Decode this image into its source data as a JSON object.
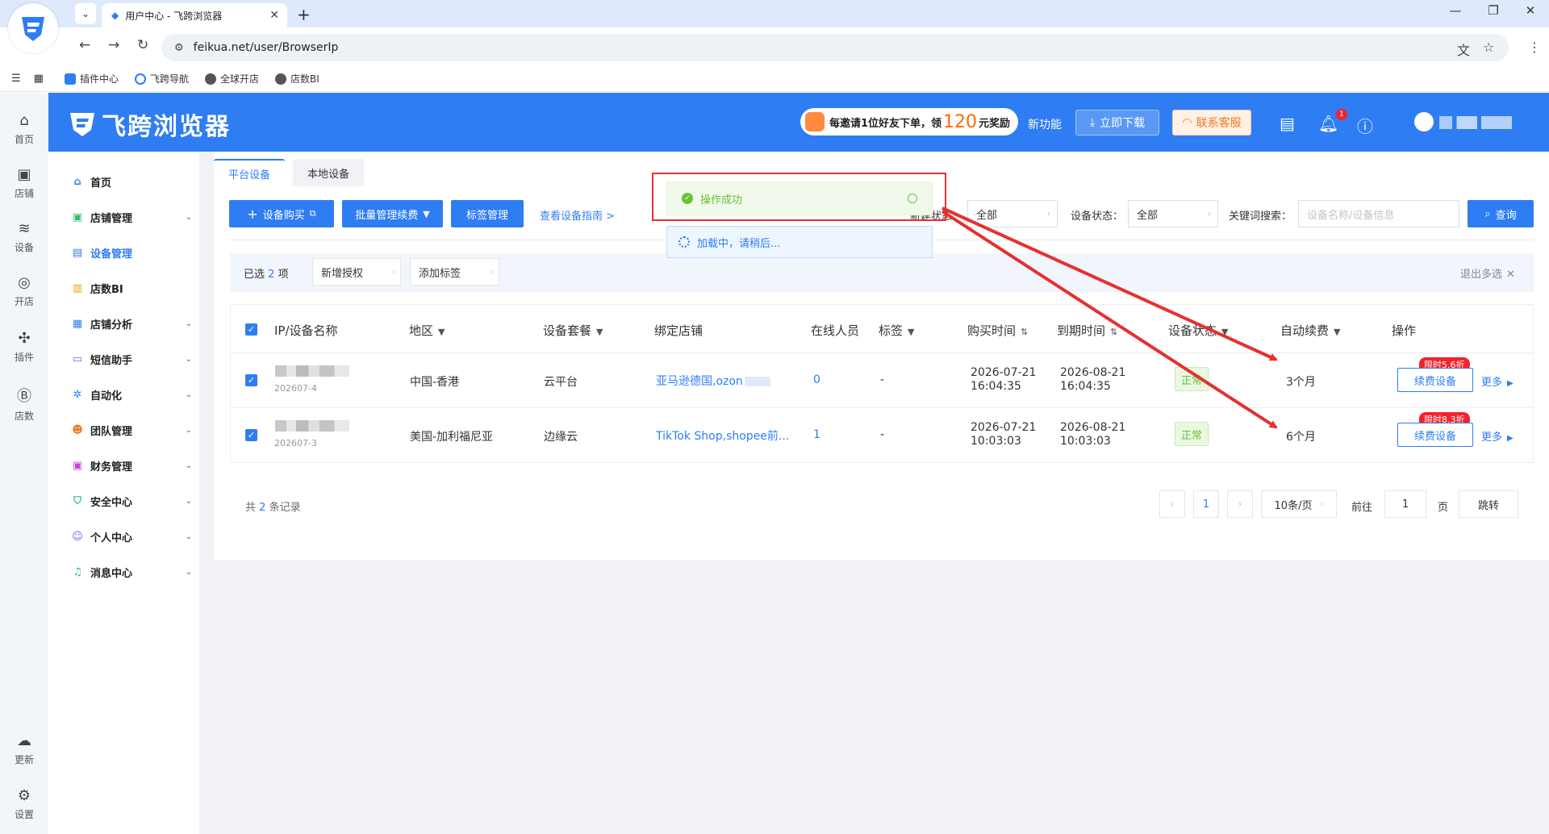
{
  "browser": {
    "tab_title": "用户中心 - 飞跨浏览器",
    "url": "feikua.net/user/BrowserIp",
    "bookmarks": [
      "插件中心",
      "飞跨导航",
      "全球开店",
      "店数BI"
    ]
  },
  "rail": {
    "items": [
      "首页",
      "店铺",
      "设备",
      "开店",
      "插件",
      "店数"
    ],
    "bottom": [
      "更新",
      "设置"
    ]
  },
  "header": {
    "brand": "飞跨浏览器",
    "invite_pre": "每邀请1位好友下单，领",
    "invite_num": "120",
    "invite_post": "元奖励",
    "new_feature": "新功能",
    "download": "立即下载",
    "contact": "联系客服",
    "bell_count": "1"
  },
  "sidebar": {
    "items": [
      {
        "label": "首页",
        "icon": "home-icon"
      },
      {
        "label": "店铺管理",
        "icon": "shop-icon"
      },
      {
        "label": "设备管理",
        "icon": "device-icon"
      },
      {
        "label": "店数BI",
        "icon": "bi-icon"
      },
      {
        "label": "店铺分析",
        "icon": "analysis-icon"
      },
      {
        "label": "短信助手",
        "icon": "sms-icon"
      },
      {
        "label": "自动化",
        "icon": "automation-icon"
      },
      {
        "label": "团队管理",
        "icon": "team-icon"
      },
      {
        "label": "财务管理",
        "icon": "wallet-icon"
      },
      {
        "label": "安全中心",
        "icon": "shield-icon"
      },
      {
        "label": "个人中心",
        "icon": "user-icon"
      },
      {
        "label": "消息中心",
        "icon": "bell-icon"
      }
    ]
  },
  "tabs": {
    "platform": "平台设备",
    "local": "本地设备"
  },
  "toolbar": {
    "buy": "设备购买",
    "batch": "批量管理续费",
    "tags": "标签管理",
    "guide": "查看设备指南 >"
  },
  "filters": {
    "status_label_partial": "新建状态：",
    "status_value": "全部",
    "device_status_label": "设备状态：",
    "device_status_value": "全部",
    "keyword_label": "关键词搜索：",
    "keyword_placeholder": "设备名称/设备信息",
    "search": "查询"
  },
  "selection": {
    "prefix": "已选",
    "count": "2",
    "suffix": "项",
    "add_auth": "新增授权",
    "add_tag": "添加标签",
    "exit": "退出多选"
  },
  "table": {
    "headers": [
      "IP/设备名称",
      "地区",
      "设备套餐",
      "绑定店铺",
      "在线人员",
      "标签",
      "购买时间",
      "到期时间",
      "设备状态",
      "自动续费",
      "操作"
    ],
    "rows": [
      {
        "id": "202607-4",
        "region": "中国-香港",
        "plan": "云平台",
        "shop": "亚马逊德国,ozon",
        "online": "0",
        "tag": "-",
        "buy_date": "2026-07-21",
        "buy_time": "16:04:35",
        "exp_date": "2026-08-21",
        "exp_time": "16:04:35",
        "status": "正常",
        "renew": "3个月",
        "discount": "限时5.6折",
        "action": "续费设备",
        "more": "更多"
      },
      {
        "id": "202607-3",
        "region": "美国-加利福尼亚",
        "plan": "边缘云",
        "shop": "TikTok Shop,shopee前...",
        "online": "1",
        "tag": "-",
        "buy_date": "2026-07-21",
        "buy_time": "10:03:03",
        "exp_date": "2026-08-21",
        "exp_time": "10:03:03",
        "status": "正常",
        "renew": "6个月",
        "discount": "限时8.3折",
        "action": "续费设备",
        "more": "更多"
      }
    ]
  },
  "pagination": {
    "total_pre": "共",
    "total": "2",
    "total_post": "条记录",
    "page": "1",
    "size": "10条/页",
    "goto": "前往",
    "goto_value": "1",
    "page_unit": "页",
    "jump": "跳转"
  },
  "toasts": {
    "success": "操作成功",
    "loading": "加载中，请稍后..."
  },
  "colors": {
    "primary": "#2f7df3",
    "success": "#67c23a",
    "annotation": "#e53030"
  }
}
